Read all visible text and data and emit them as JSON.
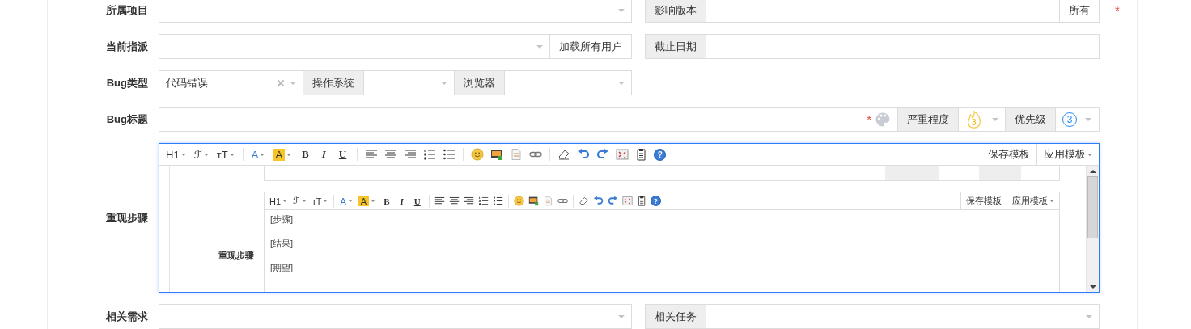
{
  "project": {
    "label": "所属项目"
  },
  "affected_version": {
    "label": "影响版本",
    "button": "所有",
    "required_mark": "*"
  },
  "assignee": {
    "label": "当前指派",
    "button": "加载所有用户"
  },
  "deadline": {
    "label": "截止日期"
  },
  "bug_type": {
    "label": "Bug类型",
    "value": "代码错误"
  },
  "os": {
    "label": "操作系统"
  },
  "browser": {
    "label": "浏览器"
  },
  "title": {
    "label": "Bug标题",
    "required_mark": "*"
  },
  "severity": {
    "label": "严重程度",
    "value": "3"
  },
  "priority": {
    "label": "优先级",
    "value": "3"
  },
  "steps": {
    "label": "重现步骤",
    "toolbar": {
      "heading": "H1",
      "font_family": "ℱ",
      "font_size": "ᴛT",
      "font_color": "A",
      "highlight": "A",
      "bold": "B",
      "italic": "I",
      "underline": "U",
      "help": "?"
    },
    "template_buttons": [
      "保存模板",
      "应用模板"
    ],
    "embedded": {
      "label": "重现步骤",
      "toolbar": {
        "heading": "H1",
        "font_family": "ℱ",
        "font_size": "ᴛT",
        "font_color": "A",
        "highlight": "A",
        "bold": "B",
        "italic": "I",
        "underline": "U",
        "help": "?"
      },
      "template_buttons": [
        "保存模板",
        "应用模板"
      ],
      "lines": [
        "[步骤]",
        "[结果]",
        "[期望]"
      ]
    }
  },
  "related_story": {
    "label": "相关需求"
  },
  "related_task": {
    "label": "相关任务"
  }
}
